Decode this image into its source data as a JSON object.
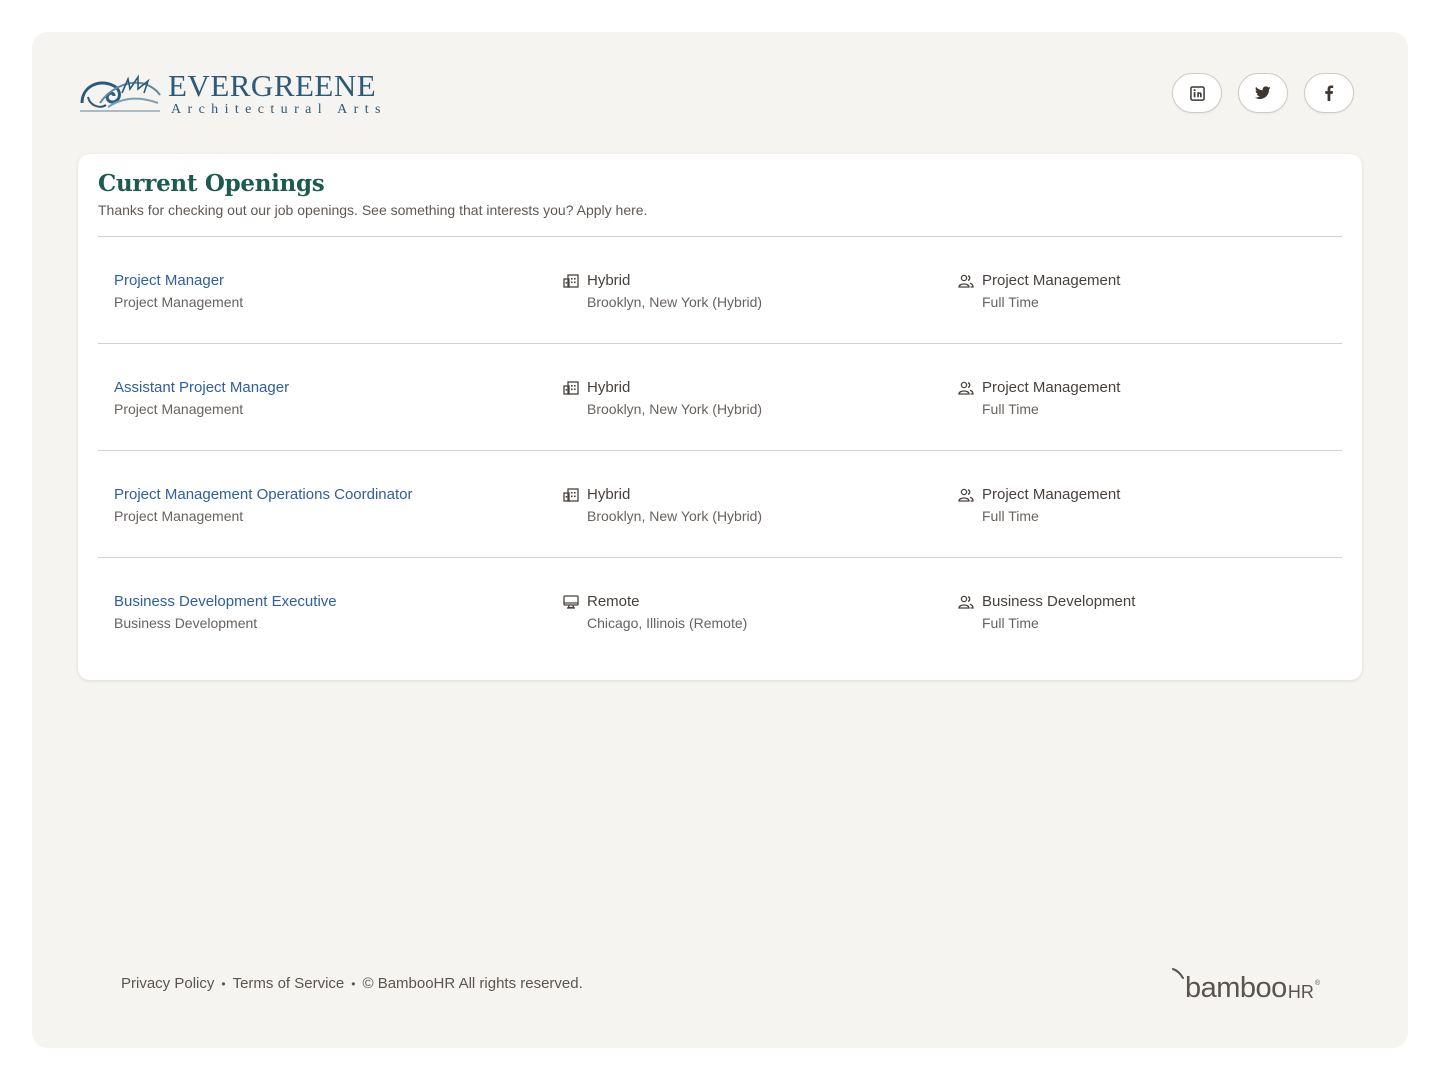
{
  "company": {
    "logo_name": "EVERGREENE",
    "logo_sub": "Architectural Arts",
    "brand_color": "#2b5b78"
  },
  "socials": [
    {
      "name": "linkedin",
      "icon": "linkedin-icon"
    },
    {
      "name": "twitter",
      "icon": "twitter-icon"
    },
    {
      "name": "facebook",
      "icon": "facebook-icon"
    }
  ],
  "openings": {
    "title": "Current Openings",
    "subtitle": "Thanks for checking out our job openings. See something that interests you? Apply here.",
    "title_color": "#1d5b50",
    "link_color": "#2e5f9e",
    "jobs": [
      {
        "title": "Project Manager",
        "department": "Project Management",
        "work_type": "Hybrid",
        "location": "Brooklyn, New York (Hybrid)",
        "work_icon": "building-icon",
        "team": "Project Management",
        "employment": "Full Time"
      },
      {
        "title": "Assistant Project Manager",
        "department": "Project Management",
        "work_type": "Hybrid",
        "location": "Brooklyn, New York (Hybrid)",
        "work_icon": "building-icon",
        "team": "Project Management",
        "employment": "Full Time"
      },
      {
        "title": "Project Management Operations Coordinator",
        "department": "Project Management",
        "work_type": "Hybrid",
        "location": "Brooklyn, New York (Hybrid)",
        "work_icon": "building-icon",
        "team": "Project Management",
        "employment": "Full Time"
      },
      {
        "title": "Business Development Executive",
        "department": "Business Development",
        "work_type": "Remote",
        "location": "Chicago, Illinois (Remote)",
        "work_icon": "monitor-icon",
        "team": "Business Development",
        "employment": "Full Time"
      }
    ]
  },
  "footer": {
    "privacy": "Privacy Policy",
    "separator": "•",
    "terms": "Terms of Service",
    "copyright": "© BambooHR All rights reserved.",
    "brand_main": "bamboo",
    "brand_hr": "HR",
    "brand_reg": "®"
  }
}
